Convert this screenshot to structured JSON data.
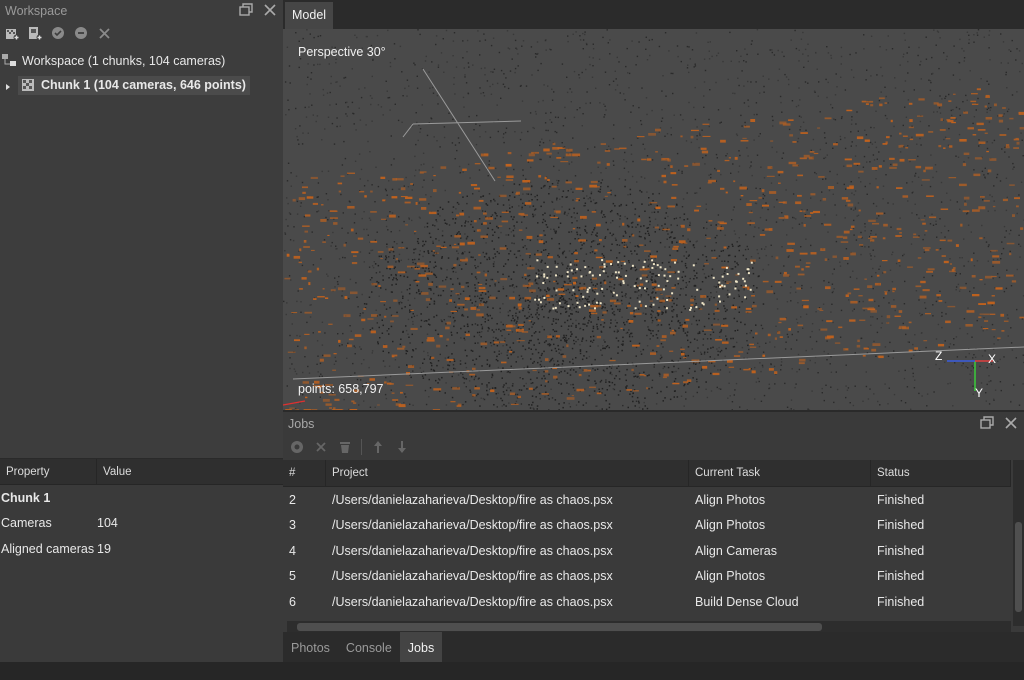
{
  "workspace": {
    "title": "Workspace",
    "root_label": "Workspace (1 chunks, 104 cameras)",
    "chunk_label": "Chunk 1 (104 cameras, 646 points)",
    "toolbar_icons": [
      "add-chunk-icon",
      "add-photos-icon",
      "enable-icon",
      "disable-icon",
      "remove-icon"
    ]
  },
  "properties": {
    "columns": [
      "Property",
      "Value"
    ],
    "group": "Chunk 1",
    "rows": [
      {
        "key": "Cameras",
        "value": "104"
      },
      {
        "key": "Aligned cameras",
        "value": "19"
      }
    ]
  },
  "model": {
    "tab_label": "Model",
    "projection_label": "Perspective 30°",
    "points_label": "points: 658,797",
    "axes": {
      "x": "X",
      "y": "Y",
      "z": "Z"
    }
  },
  "jobs": {
    "title": "Jobs",
    "columns": [
      "#",
      "Project",
      "Current Task",
      "Status"
    ],
    "rows": [
      {
        "num": "2",
        "project": "/Users/danielazaharieva/Desktop/fire as chaos.psx",
        "task": "Align Photos",
        "status": "Finished"
      },
      {
        "num": "3",
        "project": "/Users/danielazaharieva/Desktop/fire as chaos.psx",
        "task": "Align Photos",
        "status": "Finished"
      },
      {
        "num": "4",
        "project": "/Users/danielazaharieva/Desktop/fire as chaos.psx",
        "task": "Align Cameras",
        "status": "Finished"
      },
      {
        "num": "5",
        "project": "/Users/danielazaharieva/Desktop/fire as chaos.psx",
        "task": "Align Photos",
        "status": "Finished"
      },
      {
        "num": "6",
        "project": "/Users/danielazaharieva/Desktop/fire as chaos.psx",
        "task": "Build Dense Cloud",
        "status": "Finished"
      }
    ]
  },
  "bottom_tabs": [
    "Photos",
    "Console",
    "Jobs"
  ],
  "active_bottom_tab": "Jobs",
  "colors": {
    "accent_orange": "#c0621e",
    "background": "#4a4a4a",
    "panel": "#3d3d3d"
  }
}
